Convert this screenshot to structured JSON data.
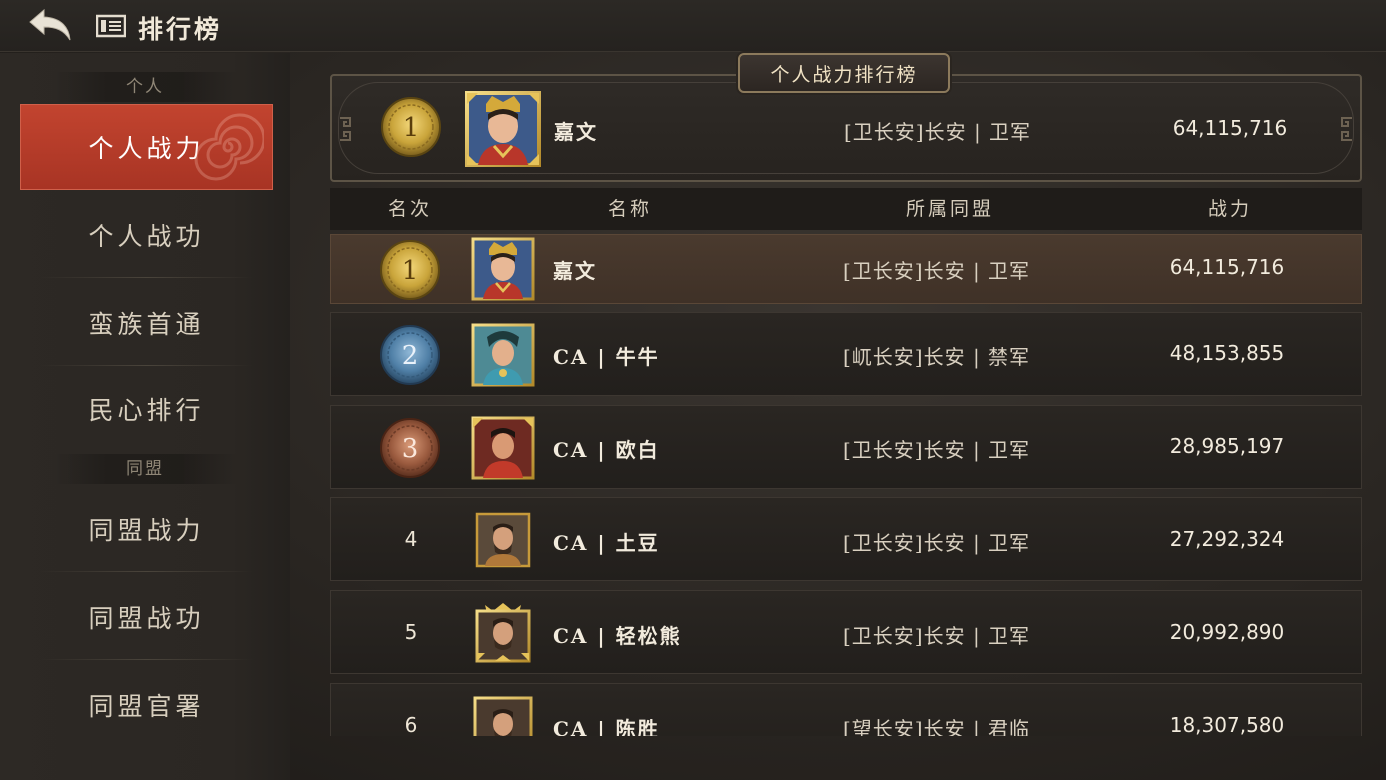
{
  "header": {
    "title": "排行榜"
  },
  "sidebar": {
    "groups": [
      {
        "label": "个人"
      },
      {
        "label": "同盟"
      }
    ],
    "items": [
      {
        "label": "个人战力"
      },
      {
        "label": "个人战功"
      },
      {
        "label": "蛮族首通"
      },
      {
        "label": "民心排行"
      },
      {
        "label": "同盟战力"
      },
      {
        "label": "同盟战功"
      },
      {
        "label": "同盟官署"
      }
    ]
  },
  "panel": {
    "banner": "个人战力排行榜",
    "self": {
      "rank": "1",
      "name": "嘉文",
      "alliance": "[卫长安]长安 | 卫军",
      "power": "64,115,716"
    }
  },
  "table": {
    "columns": [
      "名次",
      "名称",
      "所属同盟",
      "战力"
    ],
    "rows": [
      {
        "rank": "1",
        "name": "嘉文",
        "alliance": "[卫长安]长安 | 卫军",
        "power": "64,115,716"
      },
      {
        "rank": "2",
        "name": "CA | 牛牛",
        "alliance": "[屼长安]长安 | 禁军",
        "power": "48,153,855"
      },
      {
        "rank": "3",
        "name": "CA | 欧白",
        "alliance": "[卫长安]长安 | 卫军",
        "power": "28,985,197"
      },
      {
        "rank": "4",
        "name": "CA | 土豆",
        "alliance": "[卫长安]长安 | 卫军",
        "power": "27,292,324"
      },
      {
        "rank": "5",
        "name": "CA | 轻松熊",
        "alliance": "[卫长安]长安 | 卫军",
        "power": "20,992,890"
      },
      {
        "rank": "6",
        "name": "CA | 陈胜",
        "alliance": "[望长安]长安 | 君临",
        "power": "18,307,580"
      }
    ]
  },
  "colors": {
    "active_tab": "#b83a29",
    "gold_medal": "#c9a43a",
    "silver_medal": "#4f7fa6",
    "bronze_medal": "#9a5a3e",
    "highlight_row": "#45362b"
  }
}
